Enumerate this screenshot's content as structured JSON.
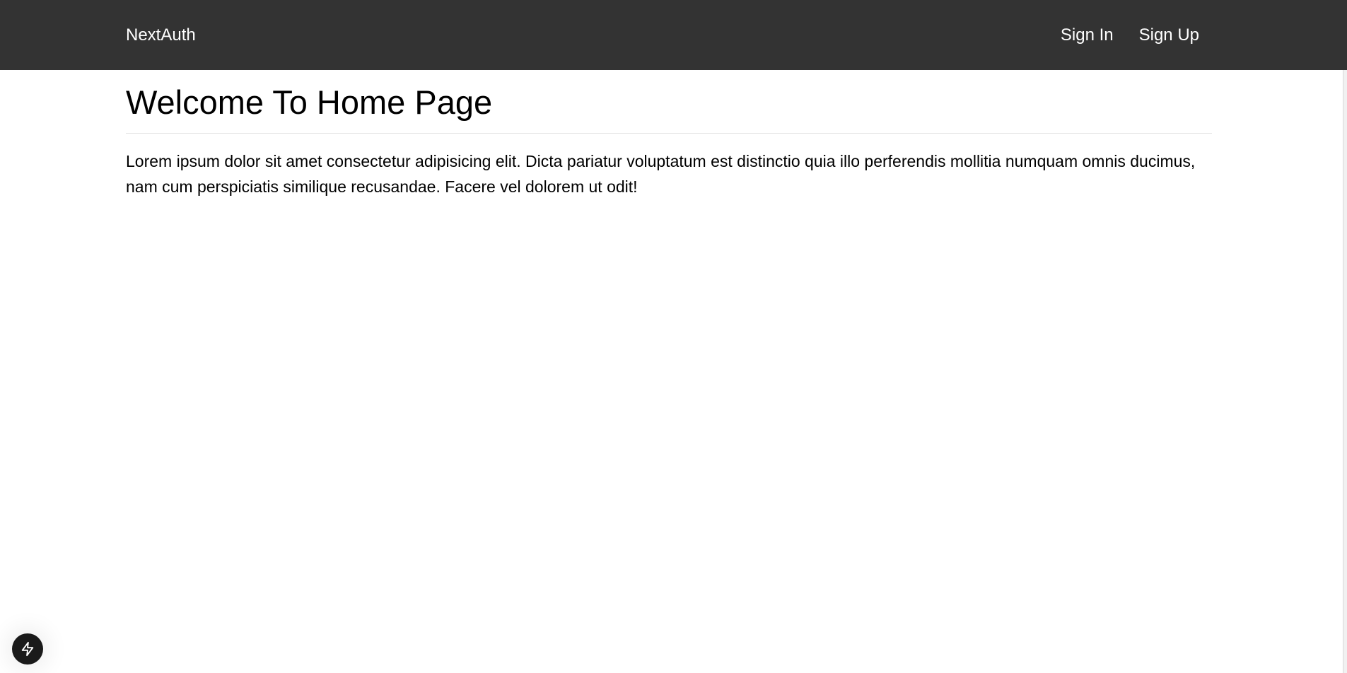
{
  "navbar": {
    "brand": "NextAuth",
    "links": [
      {
        "label": "Sign In"
      },
      {
        "label": "Sign Up"
      }
    ],
    "background": "#333333"
  },
  "main": {
    "title": "Welcome To Home Page",
    "paragraph": "Lorem ipsum dolor sit amet consectetur adipisicing elit. Dicta pariatur voluptatum est distinctio quia illo perferendis mollitia numquam omnis ducimus, nam cum perspiciatis similique recusandae. Facere vel dolorem ut odit!"
  },
  "dev_indicator": {
    "icon": "lightning-bolt-icon"
  }
}
